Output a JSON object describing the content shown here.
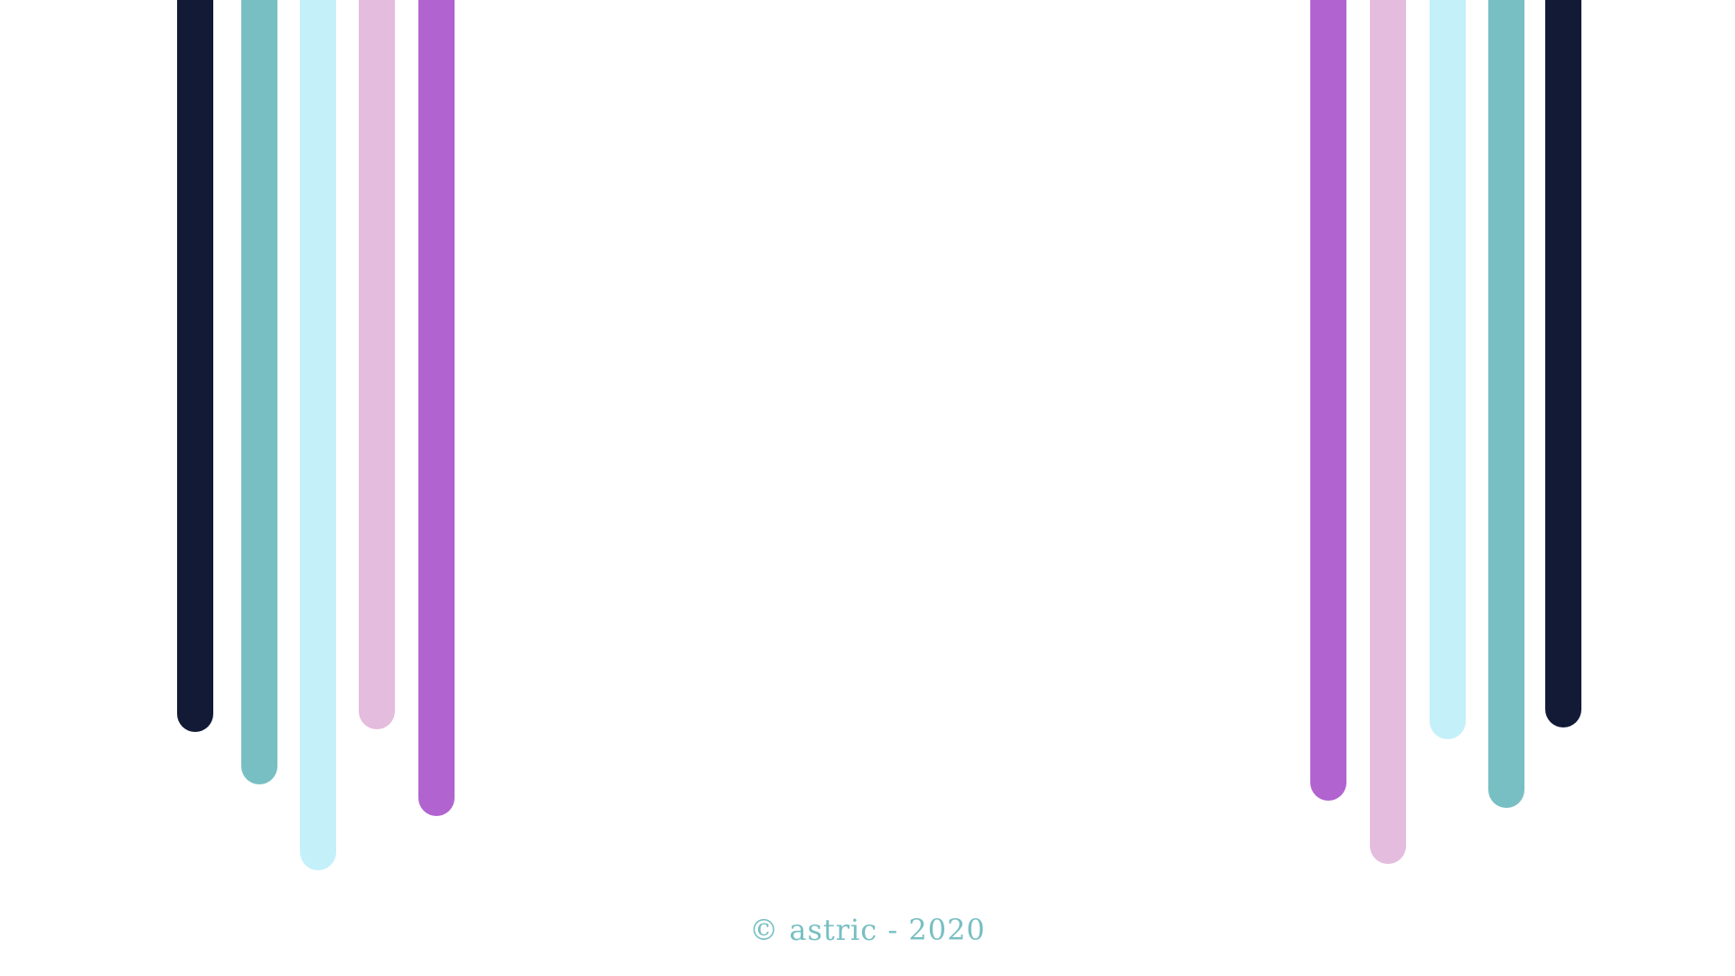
{
  "colors": {
    "navy": "#121a36",
    "teal": "#78bfc3",
    "light_cyan": "#c4f0fa",
    "pink": "#e4bcdd",
    "purple": "#b163d0",
    "footer_text": "#78bfc3",
    "background": "#ffffff"
  },
  "left_stripes": [
    {
      "color": "#121a36"
    },
    {
      "color": "#78bfc3"
    },
    {
      "color": "#c4f0fa"
    },
    {
      "color": "#e4bcdd"
    },
    {
      "color": "#b163d0"
    }
  ],
  "right_stripes": [
    {
      "color": "#b163d0"
    },
    {
      "color": "#e4bcdd"
    },
    {
      "color": "#c4f0fa"
    },
    {
      "color": "#78bfc3"
    },
    {
      "color": "#121a36"
    }
  ],
  "footer": {
    "copyright": "© astric - 2020"
  }
}
